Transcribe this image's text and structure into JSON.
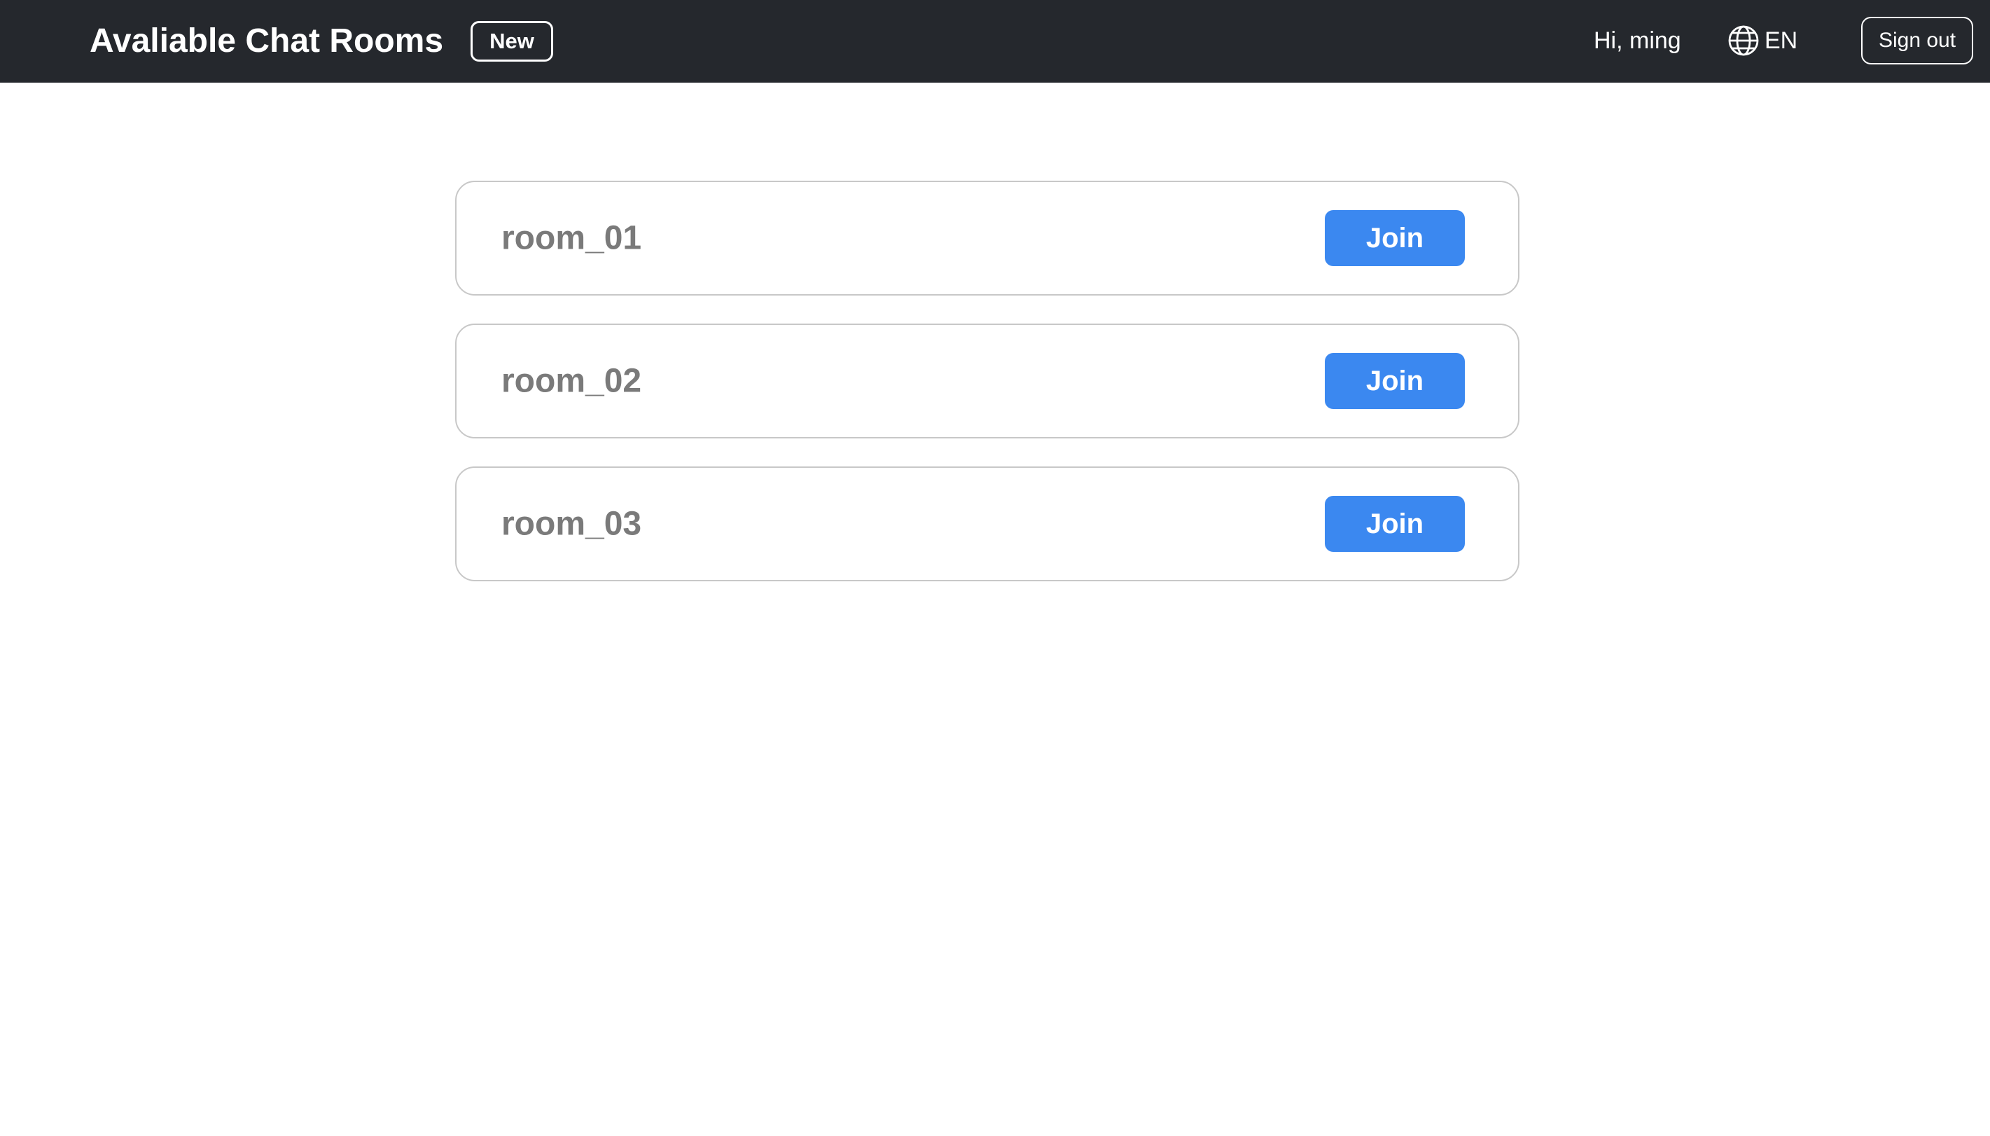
{
  "header": {
    "title": "Avaliable Chat Rooms",
    "new_label": "New",
    "greeting": "Hi, ming",
    "language": "EN",
    "signout_label": "Sign out",
    "background_color": "#25282d"
  },
  "rooms": [
    {
      "name": "room_01",
      "join_label": "Join"
    },
    {
      "name": "room_02",
      "join_label": "Join"
    },
    {
      "name": "room_03",
      "join_label": "Join"
    }
  ],
  "colors": {
    "accent": "#3b88f0",
    "room_text": "#7a7a7a",
    "card_border": "#c8c8c8"
  },
  "icons": {
    "language": "globe-icon"
  }
}
